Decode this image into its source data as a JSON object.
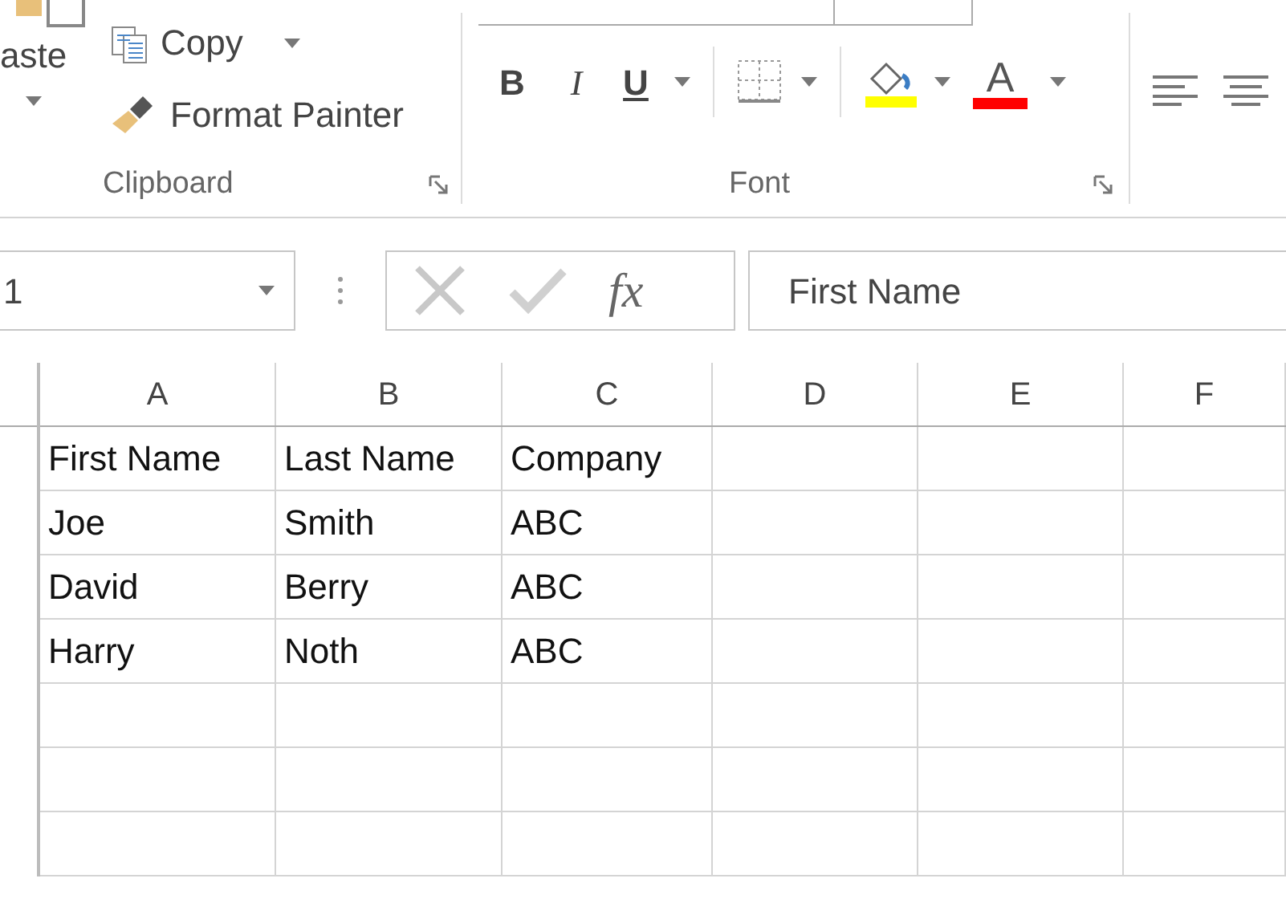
{
  "ribbon": {
    "clipboard": {
      "paste_label": "aste",
      "copy_label": "Copy",
      "format_painter_label": "Format Painter",
      "group_label": "Clipboard"
    },
    "font": {
      "bold": "B",
      "italic": "I",
      "underline": "U",
      "font_color_letter": "A",
      "group_label": "Font"
    }
  },
  "formula_bar": {
    "name_box": "1",
    "fx": "fx",
    "value": "First Name"
  },
  "sheet": {
    "columns": [
      "A",
      "B",
      "C",
      "D",
      "E",
      "F"
    ],
    "rows": [
      [
        "First Name",
        "Last Name",
        "Company"
      ],
      [
        "Joe",
        "Smith",
        "ABC"
      ],
      [
        "David",
        "Berry",
        "ABC"
      ],
      [
        "Harry",
        "Noth",
        "ABC"
      ]
    ]
  }
}
